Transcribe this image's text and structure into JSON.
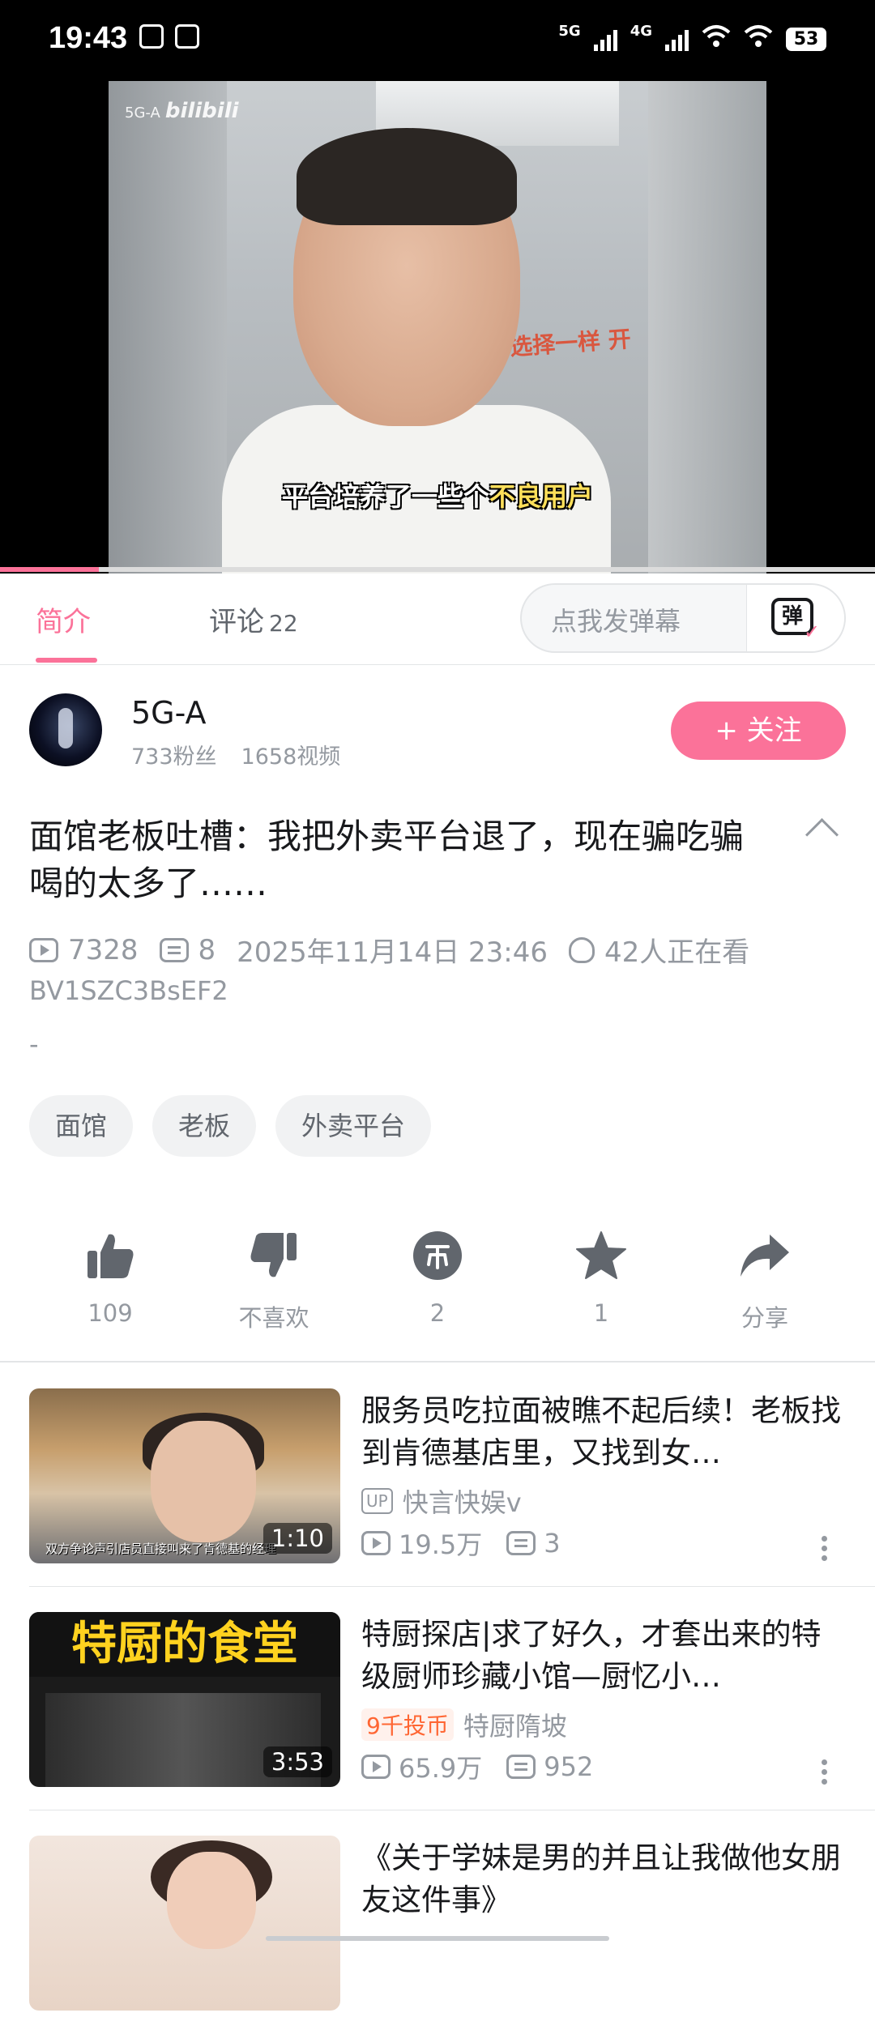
{
  "status_bar": {
    "time": "19:43",
    "network_1": "5G",
    "network_2": "4G",
    "battery": "53"
  },
  "video": {
    "watermark_channel": "5G-A",
    "watermark_brand": "bilibili",
    "subtitle_pre": "平台培养了一些个",
    "subtitle_highlight": "不良用户",
    "background_sign": "选择一样 开",
    "progress": 0.113
  },
  "tabs": {
    "intro": "简介",
    "comments": "评论",
    "comment_count": "22",
    "danmaku_placeholder": "点我发弹幕",
    "danmaku_button": "弹"
  },
  "uploader": {
    "name": "5G-A",
    "fans": "733粉丝",
    "videos": "1658视频",
    "follow_label": "+ 关注"
  },
  "video_info": {
    "title": "面馆老板吐槽：我把外卖平台退了，现在骗吃骗喝的太多了……",
    "views": "7328",
    "danmaku_count": "8",
    "datetime": "2025年11月14日 23:46",
    "watching": "42人正在看",
    "bvid": "BV1SZC3BsEF2",
    "description": "-",
    "tags": [
      "面馆",
      "老板",
      "外卖平台"
    ]
  },
  "actions": {
    "like": "109",
    "dislike": "不喜欢",
    "coin": "2",
    "favorite": "1",
    "share": "分享"
  },
  "recommendations": [
    {
      "title": "服务员吃拉面被瞧不起后续！老板找到肯德基店里，又找到女…",
      "up_badge": "UP",
      "uploader": "快言快娱v",
      "views": "19.5万",
      "danmaku": "3",
      "duration": "1:10",
      "thumb_caption": "双方争论声引店员直接叫来了肯德基的经理"
    },
    {
      "title": "特厨探店|求了好久，才套出来的特级厨师珍藏小馆—厨忆小…",
      "coin_badge": "9千投币",
      "uploader": "特厨隋坡",
      "views": "65.9万",
      "danmaku": "952",
      "duration": "3:53",
      "thumb_sign": "特厨的食堂"
    },
    {
      "title": "《关于学妹是男的并且让我做他女朋友这件事》",
      "uploader": "",
      "views": "",
      "danmaku": "",
      "duration": ""
    }
  ],
  "colors": {
    "accent": "#fb7299",
    "text_primary": "#18191c",
    "text_secondary": "#9499a0"
  }
}
